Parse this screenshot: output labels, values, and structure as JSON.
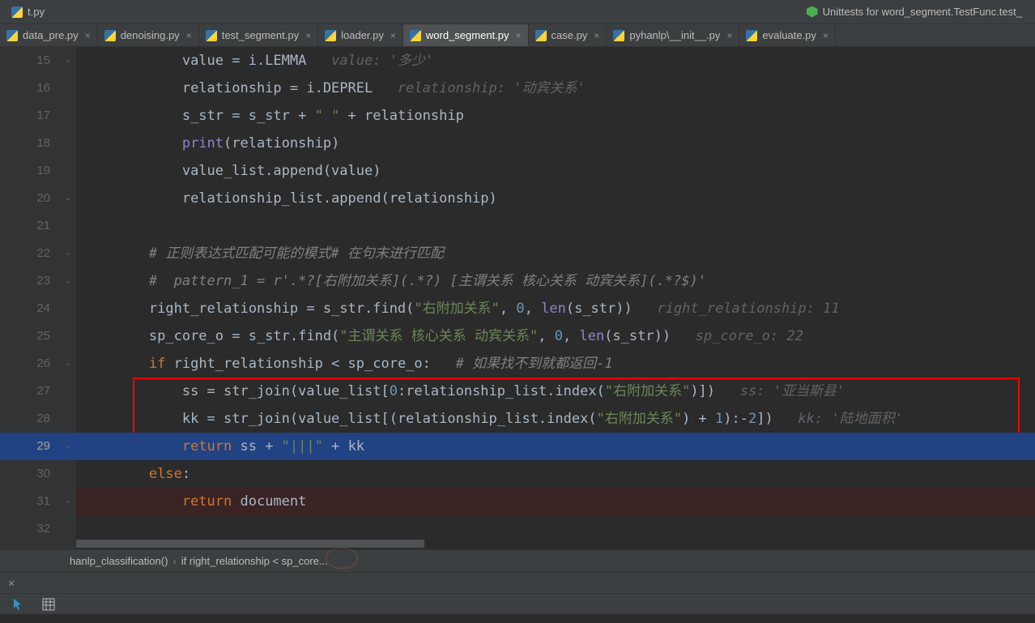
{
  "top": {
    "open_file": "t.py",
    "run_config": "Unittests for word_segment.TestFunc.test_"
  },
  "tabs": {
    "items": [
      {
        "label": "data_pre.py",
        "active": false
      },
      {
        "label": "denoising.py",
        "active": false
      },
      {
        "label": "test_segment.py",
        "active": false
      },
      {
        "label": "loader.py",
        "active": false
      },
      {
        "label": "word_segment.py",
        "active": true
      },
      {
        "label": "case.py",
        "active": false
      },
      {
        "label": "pyhanlp\\__init__.py",
        "active": false
      },
      {
        "label": "evaluate.py",
        "active": false
      }
    ]
  },
  "breadcrumb": {
    "crumb1": "hanlp_classification()",
    "crumb2": "if right_relationship < sp_core..."
  },
  "code": {
    "line_start": 15,
    "lines": [
      {
        "n": 15,
        "indent": "            ",
        "parts": [
          [
            "",
            "value = i.LEMMA   "
          ],
          [
            "hint",
            "value: '多少'"
          ]
        ]
      },
      {
        "n": 16,
        "indent": "            ",
        "parts": [
          [
            "",
            "relationship = i.DEPREL   "
          ],
          [
            "hint",
            "relationship: '动宾关系'"
          ]
        ]
      },
      {
        "n": 17,
        "indent": "            ",
        "parts": [
          [
            "",
            "s_str = s_str + "
          ],
          [
            "str",
            "\" \""
          ],
          [
            "",
            " + relationship"
          ]
        ]
      },
      {
        "n": 18,
        "indent": "            ",
        "parts": [
          [
            "builtin",
            "print"
          ],
          [
            "",
            "(relationship)"
          ]
        ]
      },
      {
        "n": 19,
        "indent": "            ",
        "parts": [
          [
            "",
            "value_list.append(value)"
          ]
        ]
      },
      {
        "n": 20,
        "indent": "            ",
        "parts": [
          [
            "",
            "relationship_list.append(relationship)"
          ]
        ]
      },
      {
        "n": 21,
        "indent": "",
        "parts": []
      },
      {
        "n": 22,
        "indent": "        ",
        "parts": [
          [
            "cm",
            "# 正则表达式匹配可能的模式# 在句末进行匹配"
          ]
        ]
      },
      {
        "n": 23,
        "indent": "        ",
        "parts": [
          [
            "cm",
            "#  pattern_1 = r'.*?[右附加关系](.*?) [主谓关系 核心关系 动宾关系](.*?$)'"
          ]
        ]
      },
      {
        "n": 24,
        "indent": "        ",
        "parts": [
          [
            "",
            "right_relationship = s_str.find("
          ],
          [
            "str",
            "\"右附加关系\""
          ],
          [
            "",
            ", "
          ],
          [
            "num",
            "0"
          ],
          [
            "",
            ", "
          ],
          [
            "builtin",
            "len"
          ],
          [
            "",
            "(s_str))   "
          ],
          [
            "hint",
            "right_relationship: 11"
          ]
        ]
      },
      {
        "n": 25,
        "indent": "        ",
        "parts": [
          [
            "",
            "sp_core_o = s_str.find("
          ],
          [
            "str",
            "\"主谓关系 核心关系 动宾关系\""
          ],
          [
            "",
            ", "
          ],
          [
            "num",
            "0"
          ],
          [
            "",
            ", "
          ],
          [
            "builtin",
            "len"
          ],
          [
            "",
            "(s_str))   "
          ],
          [
            "hint",
            "sp_core_o: 22"
          ]
        ]
      },
      {
        "n": 26,
        "indent": "        ",
        "parts": [
          [
            "kw",
            "if "
          ],
          [
            "",
            "right_relationship < sp_core_o:   "
          ],
          [
            "cm",
            "# 如果找不到就都返回-1"
          ]
        ]
      },
      {
        "n": 27,
        "indent": "            ",
        "parts": [
          [
            "",
            "ss = str_join(value_list["
          ],
          [
            "num",
            "0"
          ],
          [
            "",
            ":relationship_list.index("
          ],
          [
            "str",
            "\"右附加关系\""
          ],
          [
            "",
            ")])   "
          ],
          [
            "hint",
            "ss: '亚当斯县'"
          ]
        ]
      },
      {
        "n": 28,
        "indent": "            ",
        "parts": [
          [
            "",
            "kk = str_join(value_list[(relationship_list.index("
          ],
          [
            "str",
            "\"右附加关系\""
          ],
          [
            "",
            ") + "
          ],
          [
            "num",
            "1"
          ],
          [
            "",
            "):-"
          ],
          [
            "num",
            "2"
          ],
          [
            "",
            "])   "
          ],
          [
            "hint",
            "kk: '陆地面积'"
          ]
        ]
      },
      {
        "n": 29,
        "indent": "            ",
        "hl": true,
        "bp": true,
        "parts": [
          [
            "kw",
            "return "
          ],
          [
            "",
            "ss + "
          ],
          [
            "str",
            "\"|||\""
          ],
          [
            "",
            " + kk"
          ]
        ]
      },
      {
        "n": 30,
        "indent": "        ",
        "parts": [
          [
            "kw",
            "else"
          ],
          [
            "",
            ":"
          ]
        ]
      },
      {
        "n": 31,
        "indent": "            ",
        "bp": true,
        "bpbg": true,
        "parts": [
          [
            "kw",
            "return "
          ],
          [
            "",
            "document"
          ]
        ]
      },
      {
        "n": 32,
        "indent": "",
        "bp": true,
        "parts": []
      }
    ]
  }
}
